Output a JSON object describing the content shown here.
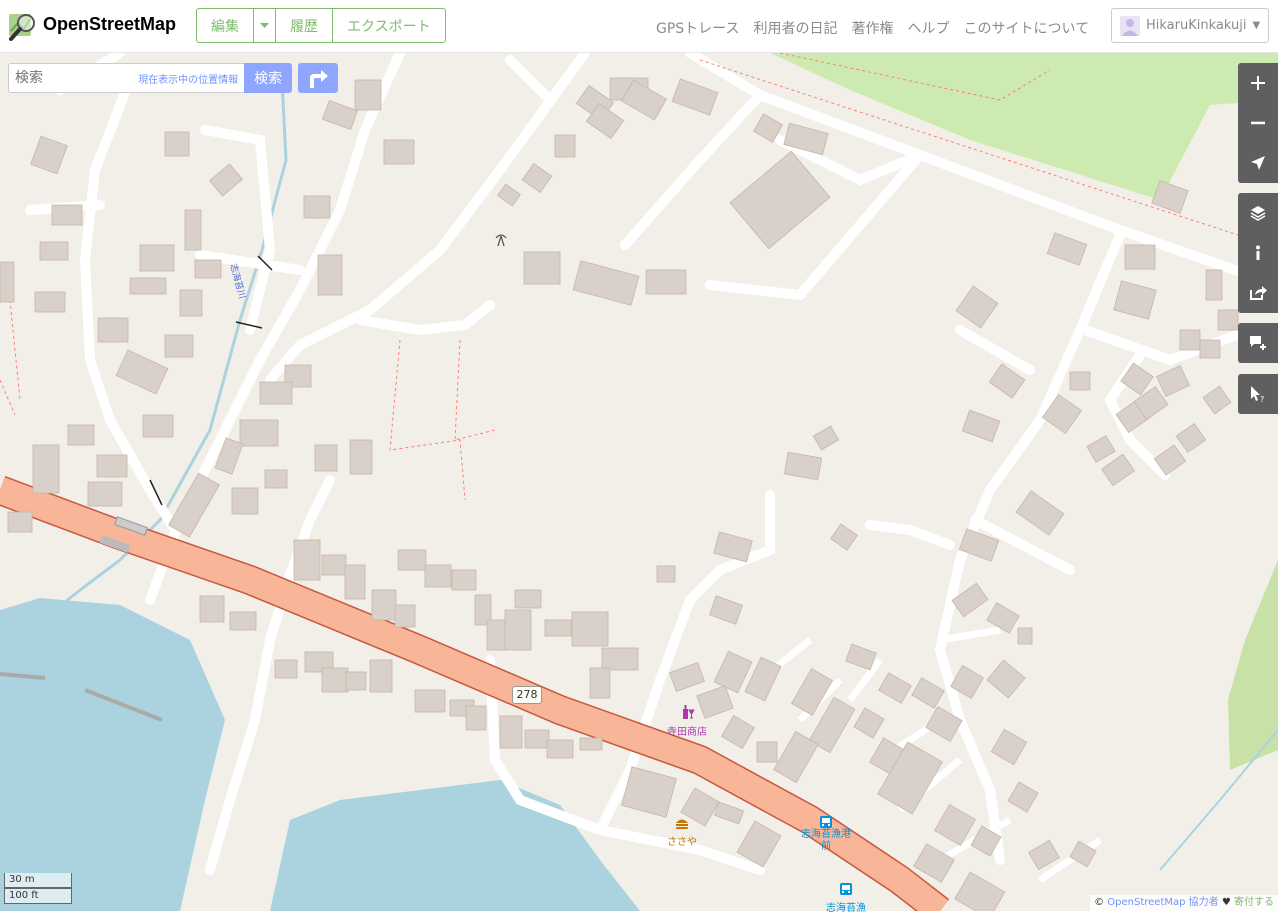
{
  "header": {
    "brand": "OpenStreetMap",
    "edit_label": "編集",
    "history_label": "履歴",
    "export_label": "エクスポート",
    "nav": [
      "GPSトレース",
      "利用者の日記",
      "著作権",
      "ヘルプ",
      "このサイトについて"
    ],
    "username": "HikaruKinkakuji"
  },
  "search": {
    "placeholder": "検索",
    "where_am_i": "現在表示中の位置情報",
    "go_label": "検索"
  },
  "map": {
    "route_label": "278",
    "stream_label": "志海苔川",
    "pois": [
      {
        "name": "寺田商店",
        "color": "#ac39ac"
      },
      {
        "name": "ささや",
        "color": "#c77400"
      },
      {
        "name": "志海苔漁港前",
        "color": "#0092da"
      },
      {
        "name": "志海苔漁",
        "color": "#0092da"
      }
    ]
  },
  "scale": {
    "metric": "30 m",
    "imperial": "100 ft"
  },
  "attribution": {
    "prefix": "©",
    "link": "OpenStreetMap",
    "contributors": "協力者",
    "heart": "♥",
    "donate": "寄付する"
  },
  "colors": {
    "brand_green": "#7ebc6f",
    "search_blue": "#8ea6ff",
    "control_gray": "#5f5f5f",
    "land": "#f2efe9",
    "water": "#aad3df",
    "road_primary": "#f8b598",
    "building": "#d9d0c9",
    "park": "#cdebb0"
  },
  "icons": [
    "magnifier-map-logo",
    "directions-icon",
    "zoom-in-icon",
    "zoom-out-icon",
    "locate-icon",
    "layers-icon",
    "info-icon",
    "share-icon",
    "add-note-icon",
    "query-features-icon",
    "avatar-icon"
  ]
}
